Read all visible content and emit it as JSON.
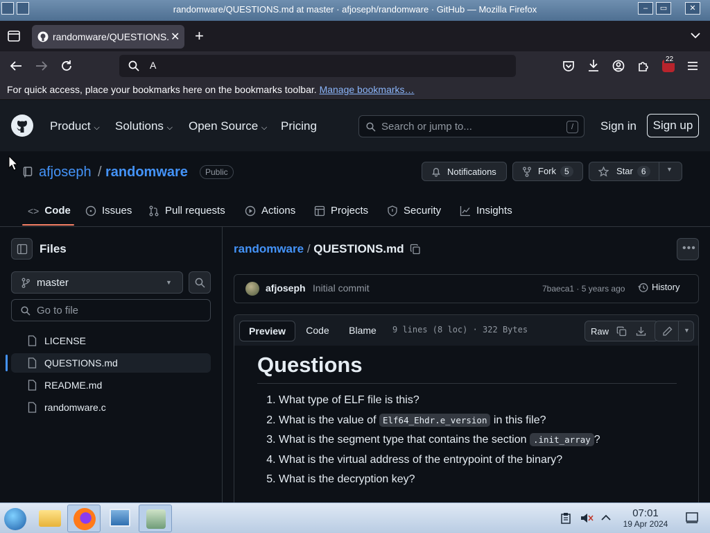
{
  "window": {
    "title": "randomware/QUESTIONS.md at master · afjoseph/randomware · GitHub — Mozilla Firefox"
  },
  "browser": {
    "tab_title": "randomware/QUESTIONS.md at master",
    "new_tab": "+",
    "url_value": "A",
    "extension_badge": "22",
    "bookmarks_message": "For quick access, place your bookmarks here on the bookmarks toolbar.",
    "bookmarks_link": "Manage bookmarks…"
  },
  "github": {
    "nav": [
      "Product",
      "Solutions",
      "Open Source",
      "Pricing"
    ],
    "search_placeholder": "Search or jump to...",
    "search_shortcut": "/",
    "sign_in": "Sign in",
    "sign_up": "Sign up"
  },
  "repo": {
    "owner": "afjoseph",
    "separator": "/",
    "name": "randomware",
    "visibility": "Public",
    "notifications": "Notifications",
    "fork_label": "Fork",
    "fork_count": "5",
    "star_label": "Star",
    "star_count": "6",
    "tabs": [
      "Code",
      "Issues",
      "Pull requests",
      "Actions",
      "Projects",
      "Security",
      "Insights"
    ]
  },
  "sidebar": {
    "title": "Files",
    "branch": "master",
    "goto_placeholder": "Go to file",
    "files": [
      "LICENSE",
      "QUESTIONS.md",
      "README.md",
      "randomware.c"
    ],
    "selected_index": 1
  },
  "file": {
    "breadcrumb_repo": "randomware",
    "breadcrumb_sep": "/",
    "filename": "QUESTIONS.md",
    "commit_author": "afjoseph",
    "commit_message": "Initial commit",
    "commit_sha": "7baeca1",
    "commit_dot": "·",
    "commit_age": "5 years ago",
    "history": "History",
    "view_tabs": [
      "Preview",
      "Code",
      "Blame"
    ],
    "stats": "9 lines (8 loc) · 322 Bytes",
    "raw": "Raw",
    "heading": "Questions",
    "questions": [
      {
        "before": "What type of ELF file is this?",
        "code": "",
        "after": ""
      },
      {
        "before": "What is the value of ",
        "code": "Elf64_Ehdr.e_version",
        "after": " in this file?"
      },
      {
        "before": "What is the segment type that contains the section ",
        "code": ".init_array",
        "after": "?"
      },
      {
        "before": "What is the virtual address of the entrypoint of the binary?",
        "code": "",
        "after": ""
      },
      {
        "before": "What is the decryption key?",
        "code": "",
        "after": ""
      }
    ]
  },
  "taskbar": {
    "time": "07:01",
    "date": "19 Apr 2024"
  },
  "colors": {
    "link": "#4493f8",
    "accent_underline": "#f78166",
    "selected_bar": "#4493f8"
  }
}
